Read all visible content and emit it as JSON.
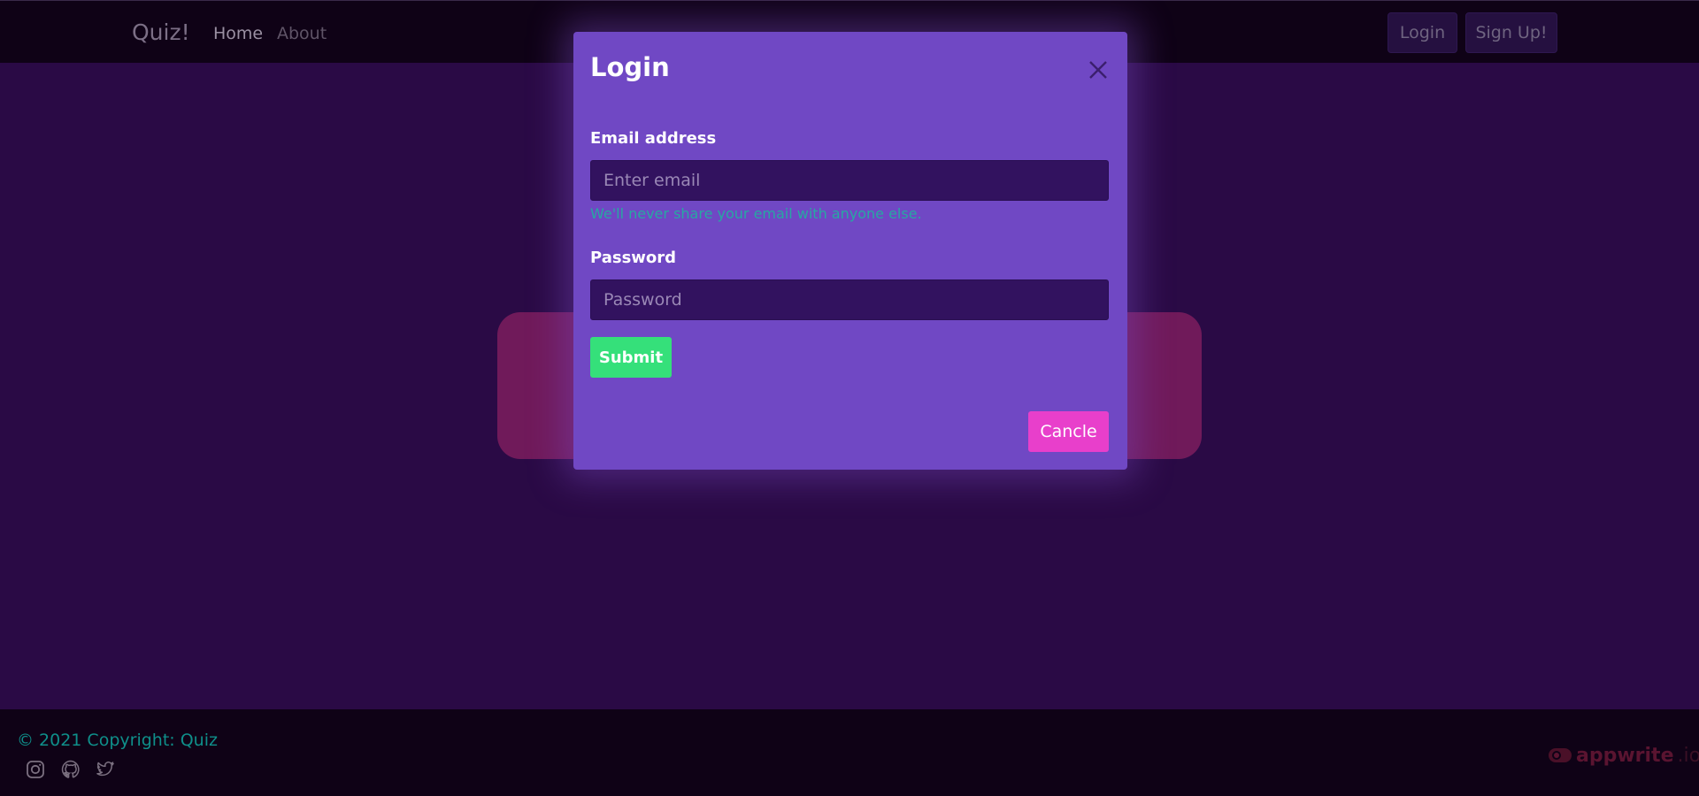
{
  "navbar": {
    "brand": "Quiz!",
    "links": [
      {
        "label": "Home"
      },
      {
        "label": "About"
      }
    ],
    "login_label": "Login",
    "signup_label": "Sign Up!"
  },
  "modal": {
    "title": "Login",
    "email": {
      "label": "Email address",
      "placeholder": "Enter email",
      "value": "",
      "help": "We'll never share your email with anyone else."
    },
    "password": {
      "label": "Password",
      "placeholder": "Password",
      "value": ""
    },
    "submit_label": "Submit",
    "cancel_label": "Cancle"
  },
  "footer": {
    "copyright": "© 2021 Copyright: Quiz",
    "social_icons": [
      "instagram-icon",
      "github-icon",
      "twitter-icon"
    ],
    "badge_brand": "appwrite",
    "badge_tld": ".io"
  },
  "colors": {
    "page_bg": "#2a0a45",
    "navbar_bg": "#0f0216",
    "modal_bg": "#7048c4",
    "input_bg": "#32125f",
    "submit": "#35e07a",
    "cancel": "#e83fcb",
    "help_text": "#27a8a2",
    "card_bg": "#701a5a"
  }
}
